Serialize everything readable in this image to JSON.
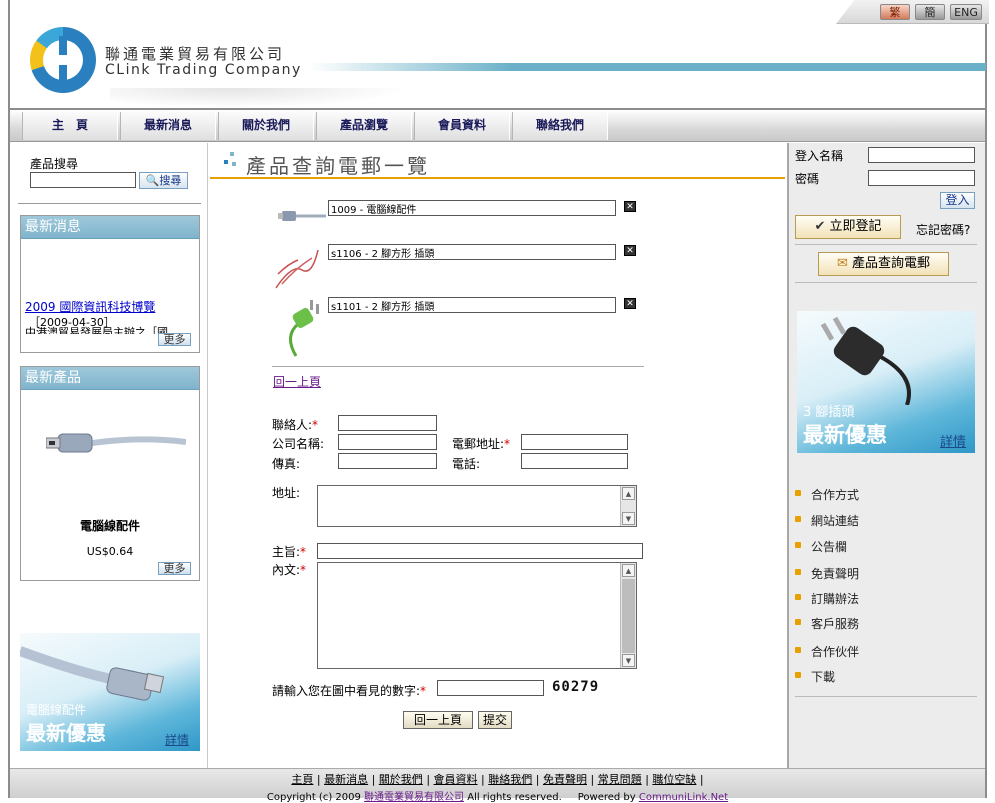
{
  "header": {
    "company_zh": "聯通電業貿易有限公司",
    "company_en": "CLink Trading Company",
    "languages": [
      "繁",
      "簡",
      "ENG"
    ]
  },
  "nav": {
    "items": [
      "主　頁",
      "最新消息",
      "關於我們",
      "產品瀏覽",
      "會員資料",
      "聯絡我們"
    ]
  },
  "left": {
    "search_label": "產品搜尋",
    "search_button": "搜尋",
    "news": {
      "title": "最新消息",
      "item_link": "2009 國際資訊科技博覽",
      "item_date": "［2009-04-30］",
      "item_text": "中港澳貿易發展局主辦之［國",
      "more": "更多"
    },
    "products": {
      "title": "最新產品",
      "name": "電腦線配件",
      "price": "US$0.64",
      "more": "更多"
    },
    "promo": {
      "line1": "電腦線配件",
      "line2": "最新優惠",
      "detail": "詳情"
    }
  },
  "main": {
    "title": "產品查詢電郵一覽",
    "items": [
      {
        "value": "1009 - 電腦線配件",
        "remove": "✕"
      },
      {
        "value": "s1106 - 2 腳方形 插頭",
        "remove": "✕"
      },
      {
        "value": "s1101 - 2 腳方形 插頭",
        "remove": "✕"
      }
    ],
    "back_link": "回一上頁",
    "form": {
      "contact_label": "聯絡人:",
      "company_label": "公司名稱:",
      "email_label": "電郵地址:",
      "fax_label": "傳真:",
      "phone_label": "電話:",
      "address_label": "地址:",
      "subject_label": "主旨:",
      "content_label": "內文:",
      "captcha_label": "請輸入您在圖中看見的數字:",
      "captcha_value": "60279",
      "required_mark": "*",
      "back_button": "回一上頁",
      "submit_button": "提交"
    }
  },
  "right": {
    "login_label": "登入名稱",
    "password_label": "密碼",
    "login_button": "登入",
    "register_button": "立即登記",
    "forgot_link": "忘記密碼?",
    "inquiry_button": "產品查詢電郵",
    "promo": {
      "line1": "3 腳插頭",
      "line2": "最新優惠",
      "detail": "詳情"
    },
    "menu": [
      "合作方式",
      "網站連結",
      "公告欄",
      "免責聲明",
      "訂購辦法",
      "客戶服務",
      "合作伙伴",
      "下載"
    ]
  },
  "footer": {
    "links": [
      "主頁",
      "最新消息",
      "關於我們",
      "會員資料",
      "聯絡我們",
      "免責聲明",
      "常見問題",
      "職位空缺"
    ],
    "separator": "|",
    "copyright_prefix": "Copyright (c) 2009",
    "copyright_company": "聯通電業貿易有限公司",
    "rights": "All rights reserved.",
    "powered_by": "Powered by",
    "powered_link": "CommuniLink.Net"
  },
  "colors": {
    "accent": "#7fb4cc",
    "title_underline": "#e8a000",
    "link": "#0000cc",
    "required": "#d00000"
  }
}
